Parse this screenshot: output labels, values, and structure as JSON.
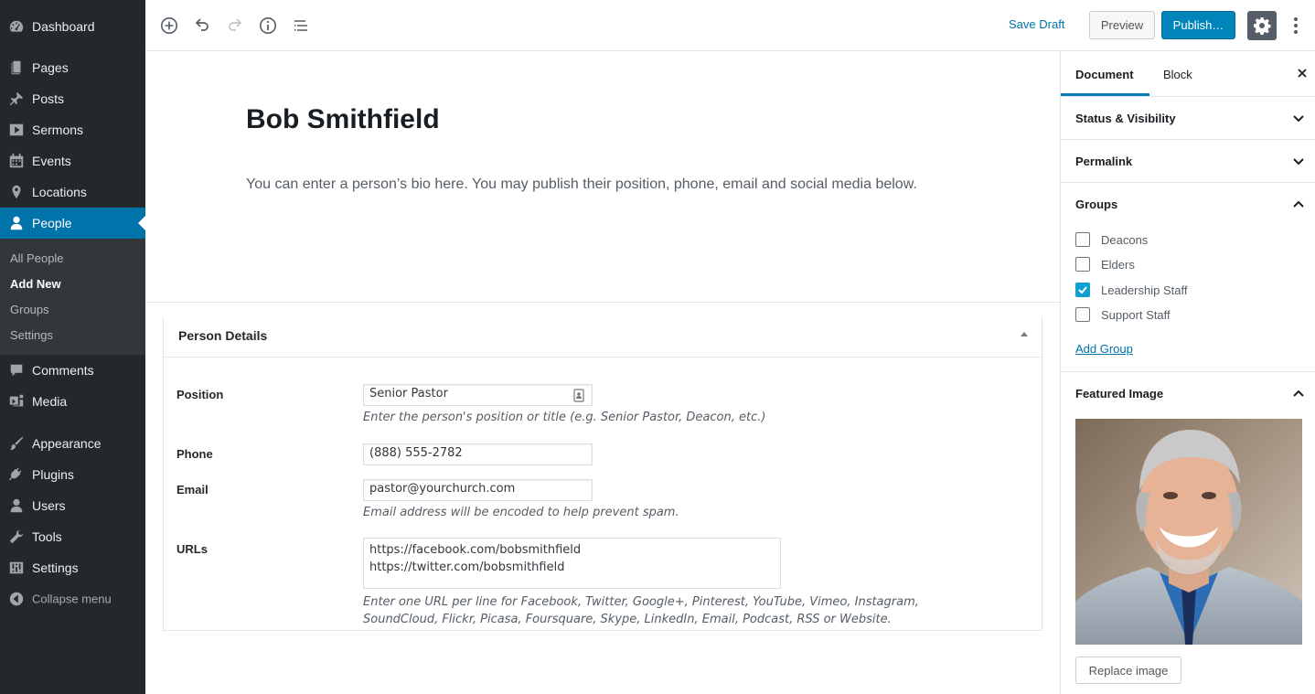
{
  "admin_menu": {
    "items": [
      {
        "label": "Dashboard",
        "icon": "dashboard-icon"
      },
      {
        "label": "Pages",
        "icon": "pages-icon"
      },
      {
        "label": "Posts",
        "icon": "pushpin-icon"
      },
      {
        "label": "Sermons",
        "icon": "video-play-icon"
      },
      {
        "label": "Events",
        "icon": "calendar-icon"
      },
      {
        "label": "Locations",
        "icon": "location-pin-icon"
      },
      {
        "label": "People",
        "icon": "person-icon"
      },
      {
        "label": "Comments",
        "icon": "speech-bubble-icon"
      },
      {
        "label": "Media",
        "icon": "media-icon"
      },
      {
        "label": "Appearance",
        "icon": "paintbrush-icon"
      },
      {
        "label": "Plugins",
        "icon": "plug-icon"
      },
      {
        "label": "Users",
        "icon": "users-icon"
      },
      {
        "label": "Tools",
        "icon": "wrench-icon"
      },
      {
        "label": "Settings",
        "icon": "sliders-icon"
      }
    ],
    "current": "People",
    "submenu": [
      "All People",
      "Add New",
      "Groups",
      "Settings"
    ],
    "submenu_current": "Add New",
    "collapse_label": "Collapse menu",
    "colors": {
      "background": "#23282d",
      "current": "#0073aa",
      "submenu_bg": "#32373c"
    }
  },
  "toolbar": {
    "icons": [
      "add-block-icon",
      "undo-icon",
      "redo-icon",
      "info-icon",
      "outline-icon"
    ],
    "save_draft": "Save Draft",
    "preview": "Preview",
    "publish": "Publish…",
    "settings_icon": "gear-icon",
    "more_icon": "more-vertical-icon"
  },
  "editor": {
    "title": "Bob Smithfield",
    "body": "You can enter a person’s bio here. You may publish their position, phone, email and social media below."
  },
  "person_details": {
    "title": "Person Details",
    "position": {
      "label": "Position",
      "value": "Senior Pastor",
      "desc": "Enter the person's position or title (e.g. Senior Pastor, Deacon, etc.)"
    },
    "phone": {
      "label": "Phone",
      "value": "(888) 555-2782"
    },
    "email": {
      "label": "Email",
      "value": "pastor@yourchurch.com",
      "desc": "Email address will be encoded to help prevent spam."
    },
    "urls": {
      "label": "URLs",
      "value": "https://facebook.com/bobsmithfield\nhttps://twitter.com/bobsmithfield",
      "desc_line1": "Enter one URL per line for Facebook, Twitter, Google+, Pinterest, YouTube, Vimeo, Instagram,",
      "desc_line2": "SoundCloud, Flickr, Picasa, Foursquare, Skype, LinkedIn, Email, Podcast, RSS or Website."
    }
  },
  "sidebar": {
    "tabs": [
      "Document",
      "Block"
    ],
    "active_tab": "Document",
    "panels": {
      "status": "Status & Visibility",
      "permalink": "Permalink",
      "groups": "Groups",
      "featured": "Featured Image"
    },
    "groups": [
      {
        "label": "Deacons",
        "checked": false
      },
      {
        "label": "Elders",
        "checked": false
      },
      {
        "label": "Leadership Staff",
        "checked": true
      },
      {
        "label": "Support Staff",
        "checked": false
      }
    ],
    "add_group": "Add Group",
    "replace_image": "Replace image"
  }
}
